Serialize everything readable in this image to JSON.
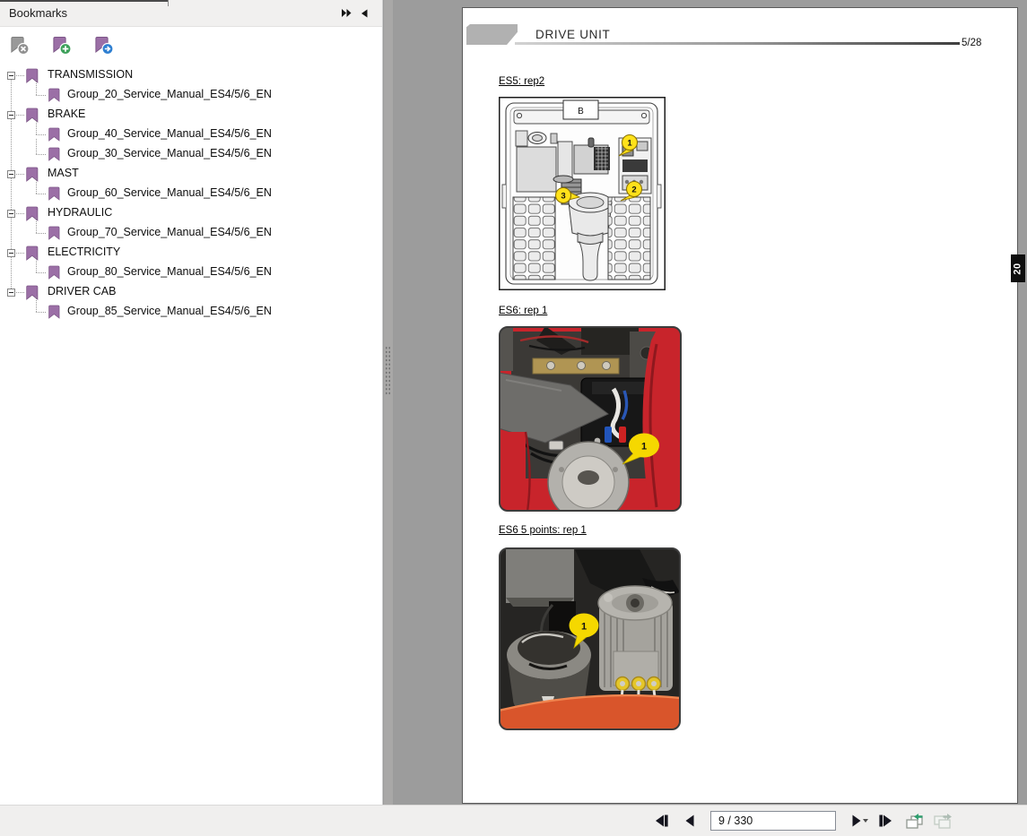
{
  "panel": {
    "title": "Bookmarks",
    "icons": {
      "expand_all": "double-chevron-right",
      "collapse_panel": "triangle-left",
      "delete_bookmark": "bookmark-flag-with-x",
      "new_bookmark": "bookmark-flag-with-plus",
      "goto_bookmark": "bookmark-flag-with-arrow"
    }
  },
  "bookmarks": [
    {
      "label": "TRANSMISSION",
      "children": [
        "Group_20_Service_Manual_ES4/5/6_EN"
      ]
    },
    {
      "label": "BRAKE",
      "children": [
        "Group_40_Service_Manual_ES4/5/6_EN",
        "Group_30_Service_Manual_ES4/5/6_EN"
      ]
    },
    {
      "label": "MAST",
      "children": [
        "Group_60_Service_Manual_ES4/5/6_EN"
      ]
    },
    {
      "label": "HYDRAULIC",
      "children": [
        "Group_70_Service_Manual_ES4/5/6_EN"
      ]
    },
    {
      "label": "ELECTRICITY",
      "children": [
        "Group_80_Service_Manual_ES4/5/6_EN"
      ]
    },
    {
      "label": "DRIVER CAB",
      "children": [
        "Group_85_Service_Manual_ES4/5/6_EN"
      ]
    }
  ],
  "page": {
    "title": "DRIVE UNIT",
    "page_of_chapter": "5/28",
    "chapter_tab": "20",
    "figures": [
      {
        "caption": "ES5: rep2",
        "label_b": "B",
        "callouts": [
          "1",
          "2",
          "3"
        ]
      },
      {
        "caption": "ES6: rep 1",
        "callouts": [
          "1"
        ]
      },
      {
        "caption": "ES6 5 points: rep 1",
        "callouts": [
          "1"
        ]
      }
    ]
  },
  "navbar": {
    "page_input": "9 / 330",
    "icons": {
      "first_page": "triangle-left-bar",
      "prev_page": "triangle-left",
      "next_page": "triangle-right",
      "last_page": "bar-triangle-right",
      "previous_view": "window-green-arrow-left",
      "next_view": "window-gray-arrow-right"
    }
  },
  "colors": {
    "bookmark_flag": "#9b6fa6",
    "badge_add": "#3da05a",
    "badge_goto": "#2e7fd1",
    "badge_delete": "#8a8a8a",
    "callout_yellow": "#ffe11a",
    "machine_red": "#c8242b",
    "workspace_gray": "#9c9c9c"
  }
}
